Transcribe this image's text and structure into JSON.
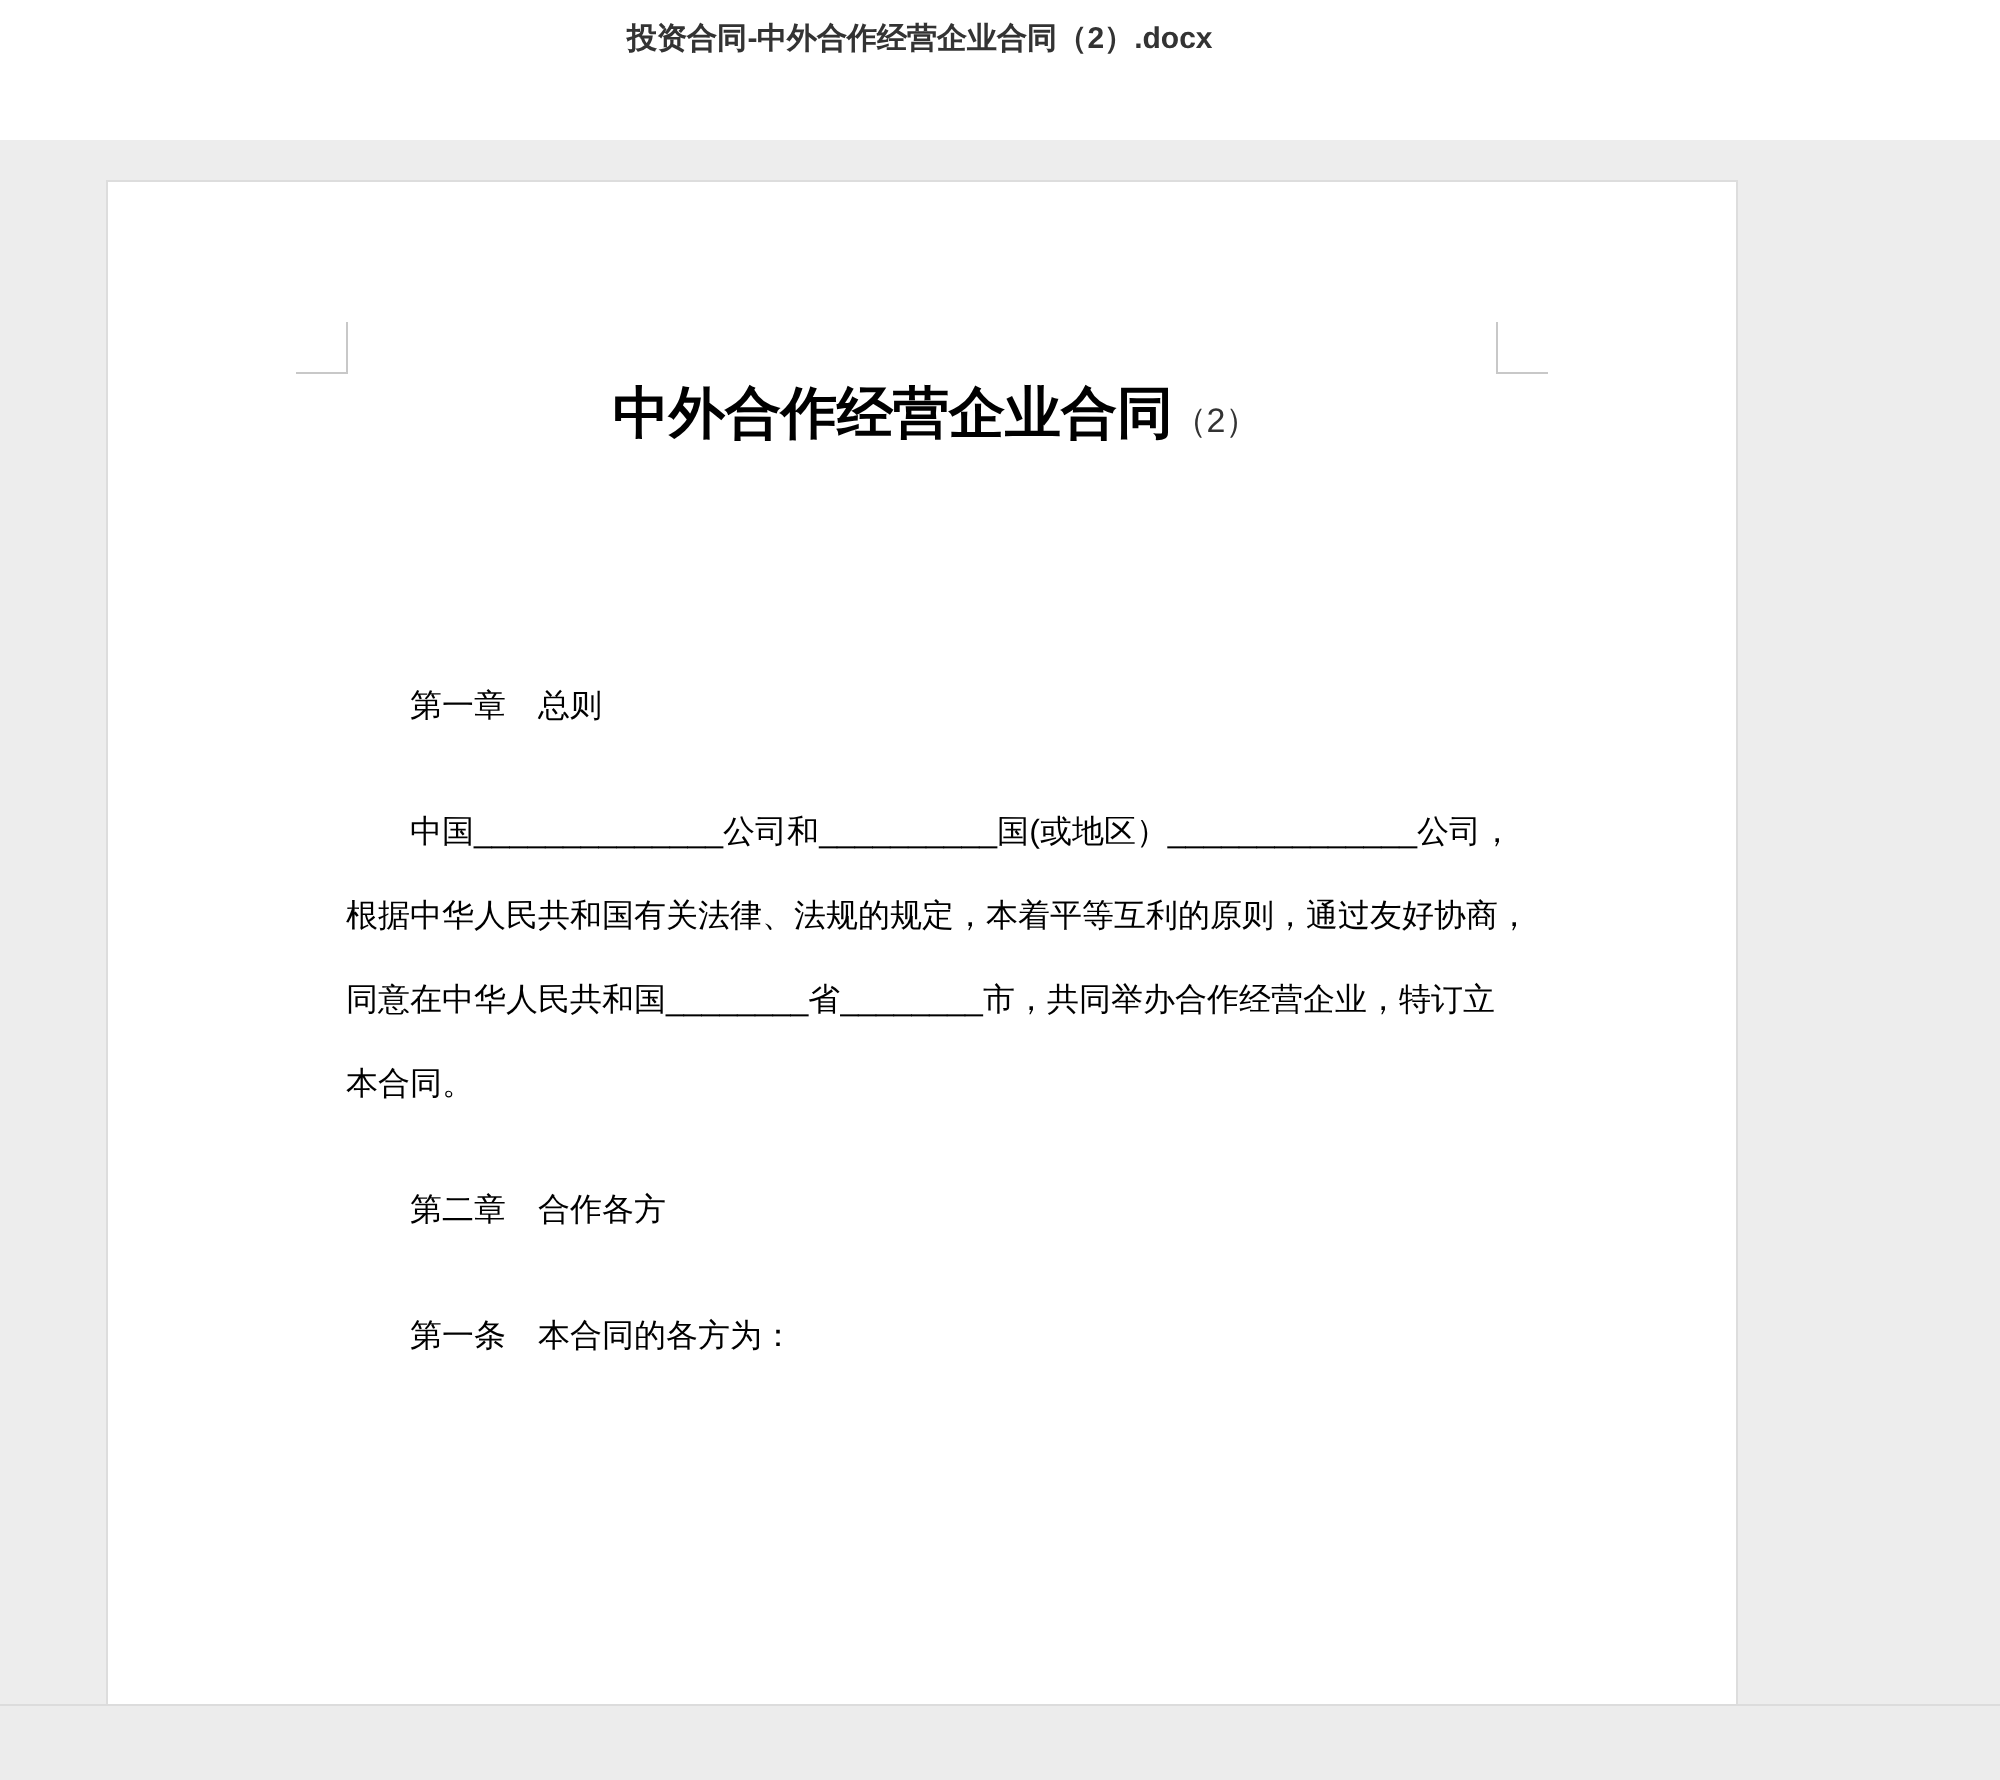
{
  "window": {
    "title": "投资合同-中外合作经营企业合同（2）.docx"
  },
  "document": {
    "title": "中外合作经营企业合同",
    "title_suffix": "（2）",
    "paragraphs": [
      {
        "lines": [
          "第一章　总则"
        ]
      },
      {
        "lines": [
          "中国______________公司和__________国(或地区）______________公司，",
          "根据中华人民共和国有关法律、法规的规定，本着平等互利的原则，通过友好协商，",
          "同意在中华人民共和国________省________市，共同举办合作经营企业，特订立",
          "本合同。"
        ]
      },
      {
        "lines": [
          "第二章　合作各方"
        ]
      },
      {
        "lines": [
          "第一条　本合同的各方为："
        ]
      }
    ]
  }
}
